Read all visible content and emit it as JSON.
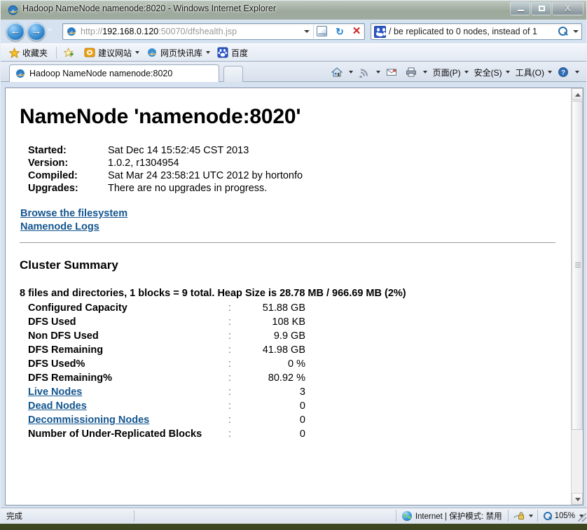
{
  "window": {
    "title": "Hadoop NameNode namenode:8020 - Windows Internet Explorer",
    "minimize_label": "Minimize",
    "restore_label": "Restore",
    "close_label": "X"
  },
  "nav": {
    "back_arrow": "←",
    "forward_arrow": "→",
    "address_scheme": "http://",
    "address_host": "192.168.0.120",
    "address_path": ":50070/dfshealth.jsp",
    "address_full": "http://192.168.0.120:50070/dfshealth.jsp",
    "search_value": "/ be replicated to 0 nodes, instead of 1"
  },
  "favorites": {
    "favorites_label": "收藏夹",
    "items": [
      {
        "label": "建议网站",
        "has_caret": true
      },
      {
        "label": "网页快讯库",
        "has_caret": true
      },
      {
        "label": "百度",
        "has_caret": false
      }
    ]
  },
  "tabs": {
    "active": "Hadoop NameNode namenode:8020"
  },
  "commandbar": {
    "items": [
      {
        "label": "页面(P)"
      },
      {
        "label": "安全(S)"
      },
      {
        "label": "工具(O)"
      }
    ]
  },
  "page": {
    "heading": "NameNode 'namenode:8020'",
    "meta": [
      {
        "key": "Started:",
        "value": "Sat Dec 14 15:52:45 CST 2013"
      },
      {
        "key": "Version:",
        "value": "1.0.2, r1304954"
      },
      {
        "key": "Compiled:",
        "value": "Sat Mar 24 23:58:21 UTC 2012 by hortonfo"
      },
      {
        "key": "Upgrades:",
        "value": "There are no upgrades in progress."
      }
    ],
    "links": [
      "Browse the filesystem",
      "Namenode Logs"
    ],
    "cluster_summary_title": "Cluster Summary",
    "summary_line": "8 files and directories, 1 blocks = 9 total. Heap Size is 28.78 MB / 966.69 MB (2%)",
    "colon": ":",
    "stats": [
      {
        "label": "Configured Capacity",
        "value": "51.88 GB",
        "link": false
      },
      {
        "label": "DFS Used",
        "value": "108 KB",
        "link": false
      },
      {
        "label": "Non DFS Used",
        "value": "9.9 GB",
        "link": false
      },
      {
        "label": "DFS Remaining",
        "value": "41.98 GB",
        "link": false
      },
      {
        "label": "DFS Used%",
        "value": "0 %",
        "link": false
      },
      {
        "label": "DFS Remaining%",
        "value": "80.92 %",
        "link": false
      },
      {
        "label": "Live Nodes",
        "value": "3",
        "link": true
      },
      {
        "label": "Dead Nodes",
        "value": "0",
        "link": true
      },
      {
        "label": "Decommissioning Nodes",
        "value": "0",
        "link": true
      },
      {
        "label": "Number of Under-Replicated Blocks",
        "value": "0",
        "link": false
      }
    ]
  },
  "statusbar": {
    "status": "完成",
    "zone": "Internet | 保护模式: 禁用",
    "zoom": "105%"
  },
  "colors": {
    "link": "#14568f",
    "page_bg": "#ffffff",
    "chrome": "#d6e2f0"
  }
}
